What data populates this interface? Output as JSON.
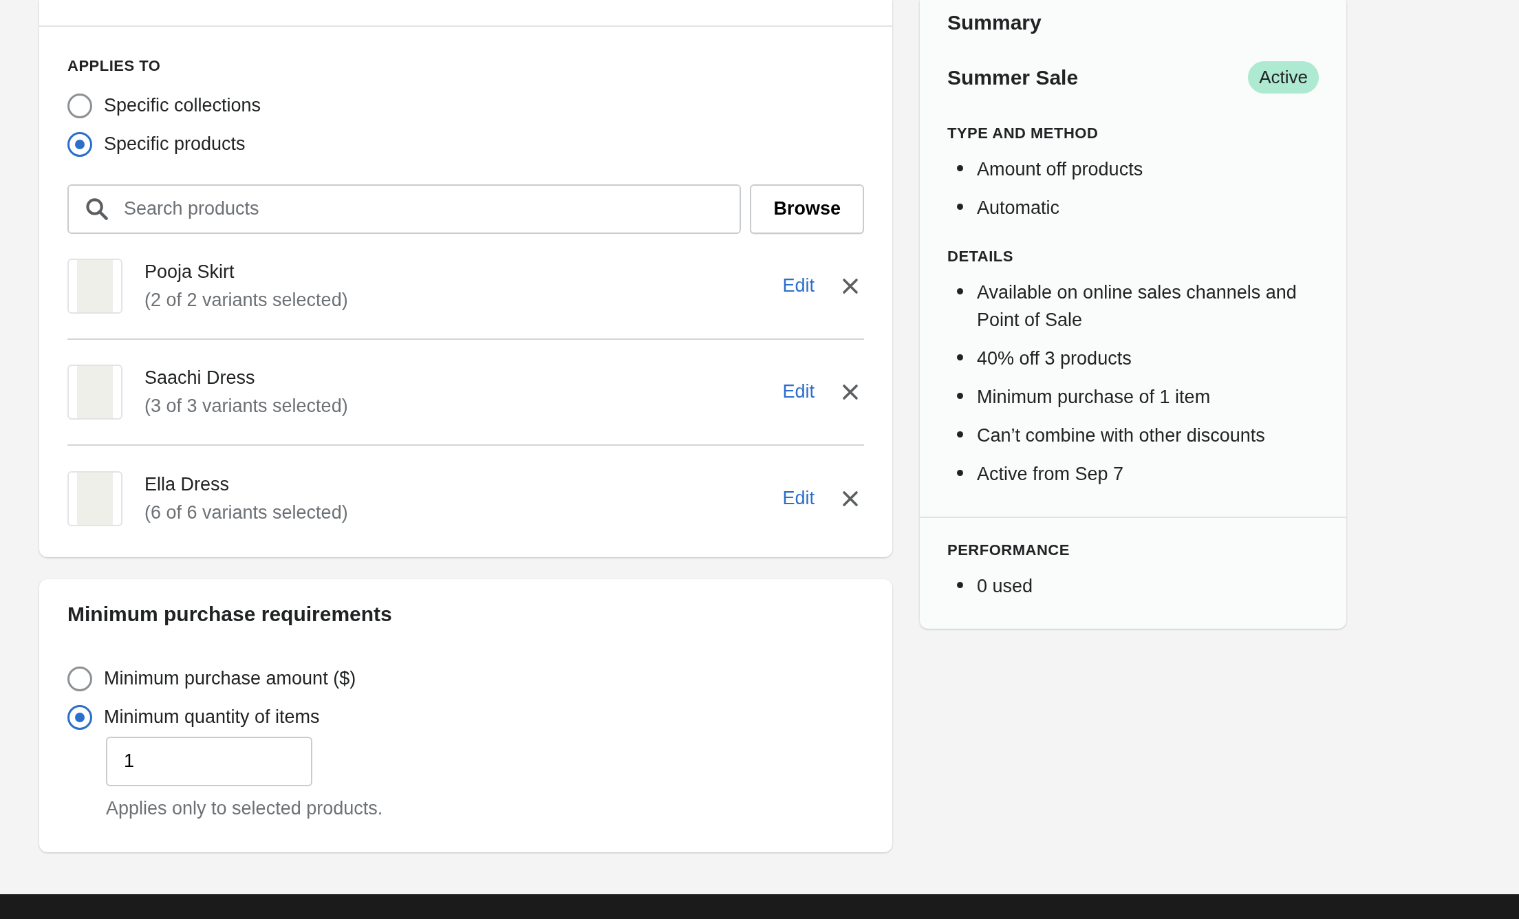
{
  "applies_to": {
    "heading": "APPLIES TO",
    "options": [
      {
        "label": "Specific collections",
        "selected": false
      },
      {
        "label": "Specific products",
        "selected": true
      }
    ],
    "search": {
      "placeholder": "Search products"
    },
    "browse_button": "Browse",
    "products": [
      {
        "name": "Pooja Skirt",
        "variants": "(2 of 2 variants selected)",
        "edit": "Edit"
      },
      {
        "name": "Saachi Dress",
        "variants": "(3 of 3 variants selected)",
        "edit": "Edit"
      },
      {
        "name": "Ella Dress",
        "variants": "(6 of 6 variants selected)",
        "edit": "Edit"
      }
    ]
  },
  "minimum_requirements": {
    "title": "Minimum purchase requirements",
    "options": [
      {
        "label": "Minimum purchase amount ($)",
        "selected": false
      },
      {
        "label": "Minimum quantity of items",
        "selected": true
      }
    ],
    "quantity_value": "1",
    "help": "Applies only to selected products."
  },
  "summary": {
    "title": "Summary",
    "discount_name": "Summer Sale",
    "status": "Active",
    "sections": [
      {
        "heading": "TYPE AND METHOD",
        "items": [
          "Amount off products",
          "Automatic"
        ]
      },
      {
        "heading": "DETAILS",
        "items": [
          "Available on online sales channels and Point of Sale",
          "40% off 3 products",
          "Minimum purchase of 1 item",
          "Can’t combine with other discounts",
          "Active from Sep 7"
        ]
      }
    ],
    "performance": {
      "heading": "PERFORMANCE",
      "items": [
        "0 used"
      ]
    }
  }
}
